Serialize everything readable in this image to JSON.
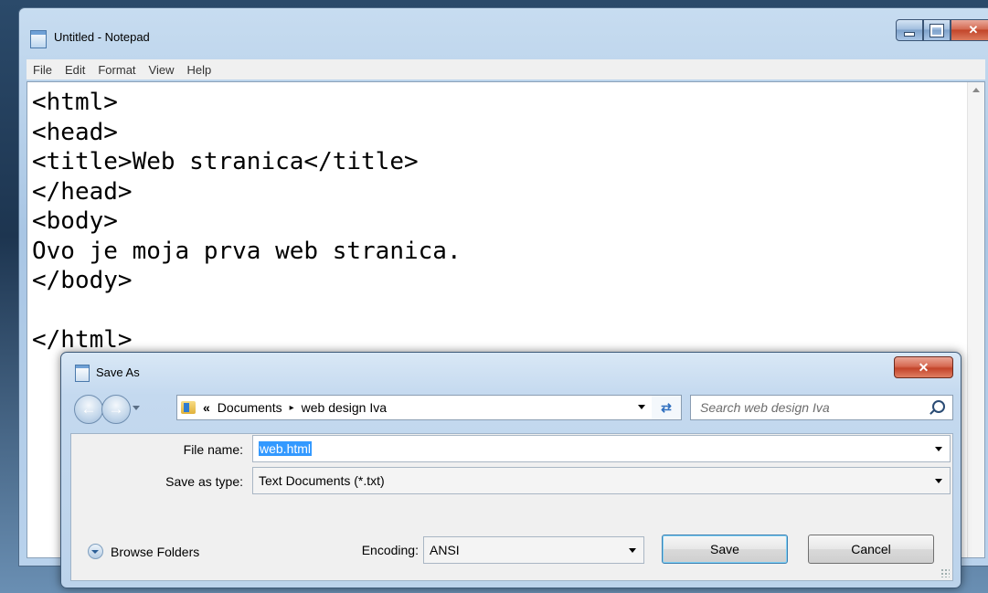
{
  "notepad": {
    "title": "Untitled - Notepad",
    "menu": [
      "File",
      "Edit",
      "Format",
      "View",
      "Help"
    ],
    "content": "<html>\n<head>\n<title>Web stranica</title>\n</head>\n<body>\nOvo je moja prva web stranica.\n</body>\n\n</html>",
    "caption_buttons": {
      "minimize": "minimize-icon",
      "maximize": "maximize-icon",
      "close": "✕"
    }
  },
  "dialog": {
    "title": "Save As",
    "close_glyph": "✕",
    "address": {
      "overflow": "«",
      "crumbs": [
        "Documents",
        "web design Iva"
      ],
      "separator": "▸"
    },
    "search_placeholder": "Search web design Iva",
    "file_name_label": "File name:",
    "file_name_value": "web.html",
    "save_as_type_label": "Save as type:",
    "save_as_type_value": "Text Documents (*.txt)",
    "browse_folders": "Browse Folders",
    "encoding_label": "Encoding:",
    "encoding_value": "ANSI",
    "save_button": "Save",
    "cancel_button": "Cancel"
  }
}
